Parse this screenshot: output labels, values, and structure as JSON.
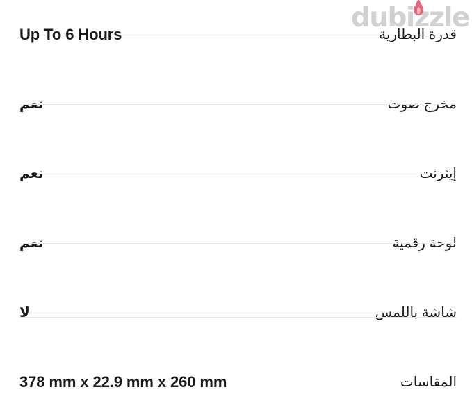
{
  "watermark": {
    "brand": "dubizzle",
    "icon": "flame-icon",
    "flame_color": "#e8657a",
    "text_color": "#cfcfd2"
  },
  "table": {
    "name": "product-specifications",
    "divider_color": "#e9e9ea",
    "text_color": "#1a1a1a",
    "background": "#ffffff",
    "rows": [
      {
        "label": "قدرة البطارية",
        "label_en": "Battery capacity",
        "value": "Up To 6 Hours",
        "value_script": "latin",
        "divider_below": "single"
      },
      {
        "label": "مخرج صوت",
        "label_en": "Audio output",
        "value": "نعم",
        "value_script": "arabic",
        "divider_below": "single"
      },
      {
        "label": "إيثرنت",
        "label_en": "Ethernet",
        "value": "نعم",
        "value_script": "arabic",
        "divider_below": "single"
      },
      {
        "label": "لوحة رقمية",
        "label_en": "Numeric keypad",
        "value": "نعم",
        "value_script": "arabic",
        "divider_below": "single"
      },
      {
        "label": "شاشة باللمس",
        "label_en": "Touch screen",
        "value": "لا",
        "value_script": "arabic",
        "divider_below": "double"
      },
      {
        "label": "المقاسات",
        "label_en": "Dimensions",
        "value": "378 mm x 22.9 mm x 260 mm",
        "value_script": "latin",
        "divider_below": "none"
      }
    ]
  }
}
